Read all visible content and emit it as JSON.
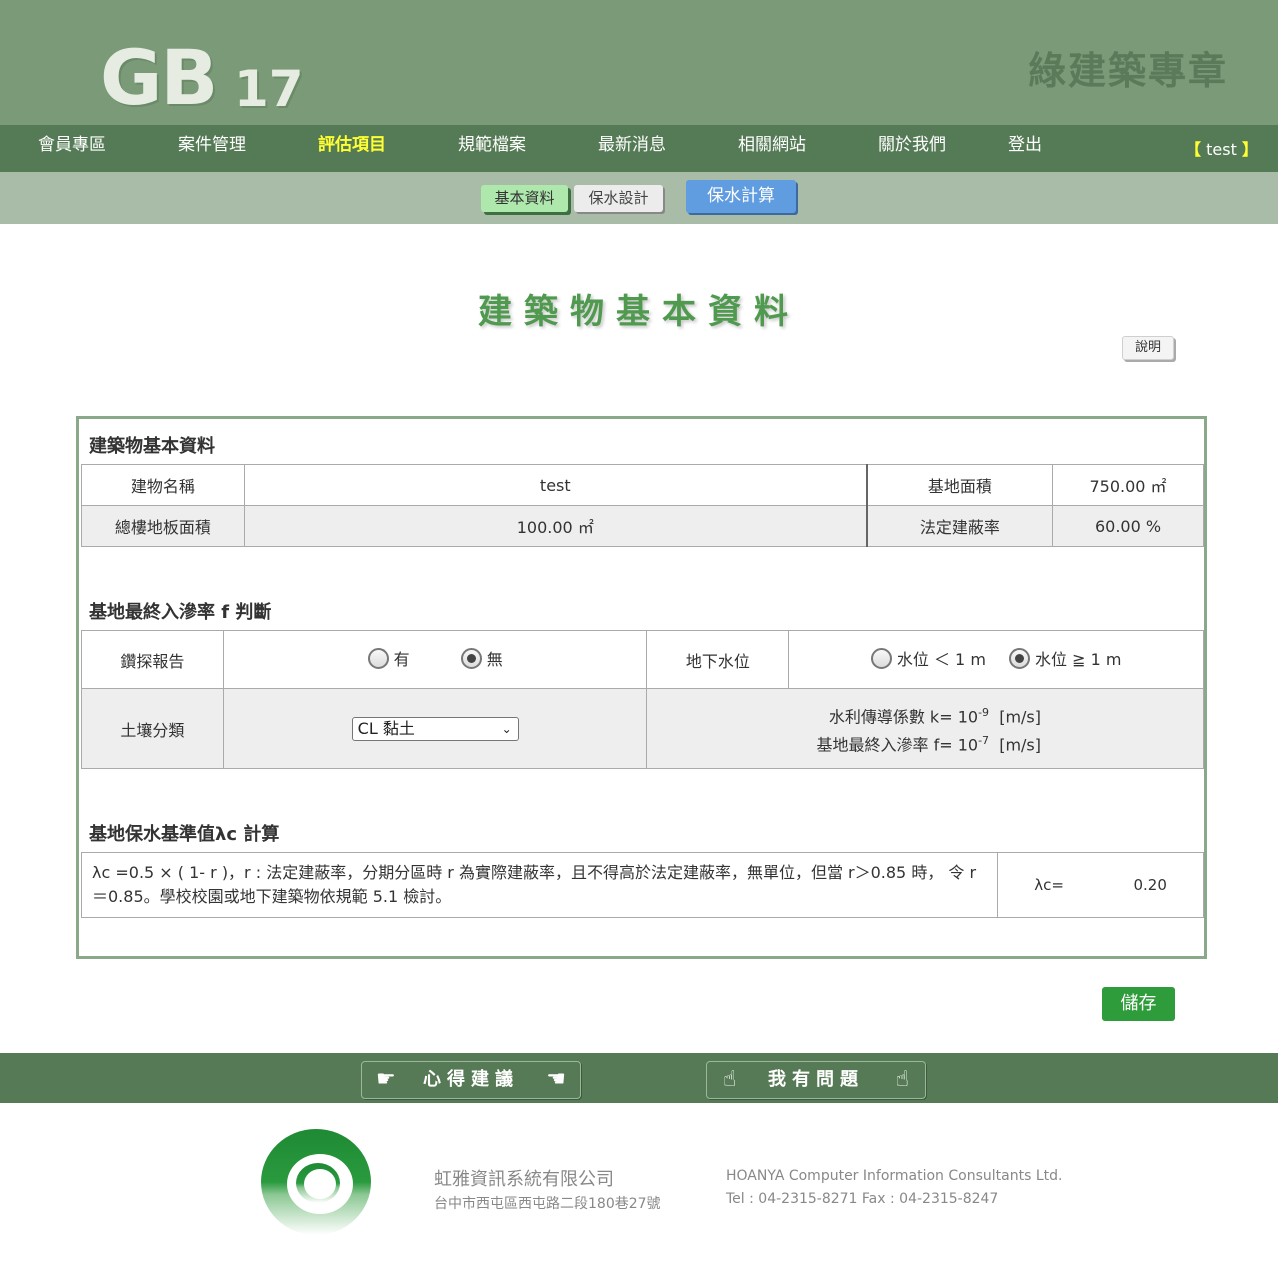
{
  "header": {
    "logo_main": "GB",
    "logo_sub": "17",
    "site_title": "綠建築專章"
  },
  "nav": {
    "items": [
      {
        "label": "會員專區"
      },
      {
        "label": "案件管理"
      },
      {
        "label": "評估項目",
        "active": true
      },
      {
        "label": "規範檔案"
      },
      {
        "label": "最新消息"
      },
      {
        "label": "相關網站"
      },
      {
        "label": "關於我們"
      },
      {
        "label": "登出"
      }
    ],
    "user_open": "【",
    "user_name": "test",
    "user_close": "】"
  },
  "subnav": {
    "basic": "基本資料",
    "design": "保水設計",
    "calc": "保水計算"
  },
  "page": {
    "title": "建築物基本資料",
    "help": "說明"
  },
  "section1": {
    "title": "建築物基本資料",
    "building_name_label": "建物名稱",
    "building_name_value": "test",
    "site_area_label": "基地面積",
    "site_area_value": "750.00 ㎡",
    "floor_area_label": "總樓地板面積",
    "floor_area_value": "100.00 ㎡",
    "coverage_label": "法定建蔽率",
    "coverage_value": "60.00 %"
  },
  "section2": {
    "title": "基地最終入滲率 f 判斷",
    "drill_label": "鑽探報告",
    "drill_yes": "有",
    "drill_no": "無",
    "drill_selected": "無",
    "groundwater_label": "地下水位",
    "gw_low": "水位 ＜ 1 m",
    "gw_high": "水位 ≧ 1 m",
    "gw_selected": "水位 ≧ 1 m",
    "soil_label": "土壤分類",
    "soil_selected": "CL 黏土",
    "k_label": "水利傳導係數 k= 10",
    "k_exp": "-9",
    "k_unit": "[m/s]",
    "f_label": "基地最終入滲率 f= 10",
    "f_exp": "-7",
    "f_unit": "[m/s]"
  },
  "section3": {
    "title": "基地保水基準值λc 計算",
    "formula": "λc =0.5 × ( 1- r )，r : 法定建蔽率，分期分區時 r 為實際建蔽率，且不得高於法定建蔽率，無單位，但當 r＞0.85 時， 令 r＝0.85。學校校園或地下建築物依規範 5.1 檢討。",
    "lambda_label": "λc=",
    "lambda_value": "0.20"
  },
  "actions": {
    "save": "儲存"
  },
  "footer": {
    "feedback": "心得建議",
    "question": "我有問題",
    "company_cn": "虹雅資訊系統有限公司",
    "address_cn": "台中市西屯區西屯路二段180巷27號",
    "company_en": "HOANYA Computer Information Consultants Ltd.",
    "contact": "Tel : 04-2315-8271    Fax : 04-2315-8247"
  }
}
